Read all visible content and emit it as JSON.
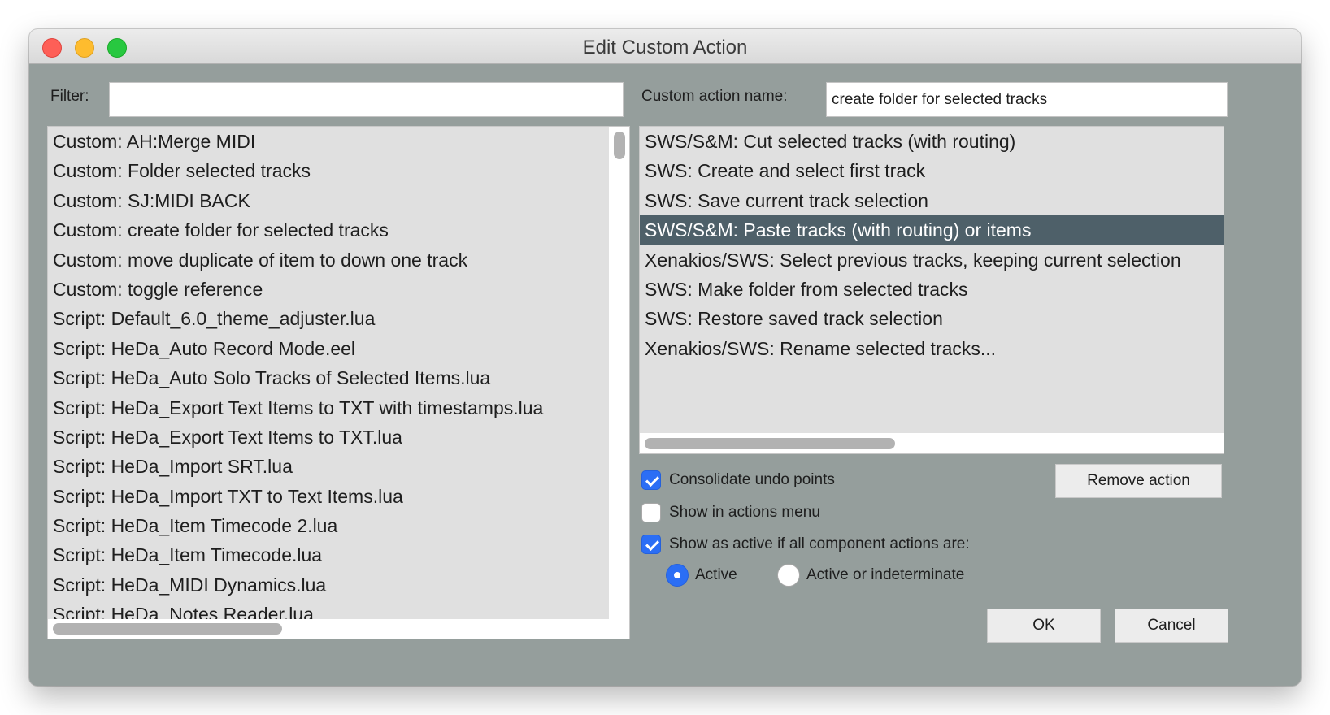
{
  "window": {
    "title": "Edit Custom Action"
  },
  "filter": {
    "label": "Filter:",
    "value": ""
  },
  "name_field": {
    "label": "Custom action name:",
    "value": "create folder for selected tracks"
  },
  "left_list": {
    "items": [
      "Custom: AH:Merge MIDI",
      "Custom: Folder selected tracks",
      "Custom: SJ:MIDI BACK",
      "Custom: create folder for selected tracks",
      "Custom: move duplicate of item to down one track",
      "Custom: toggle reference",
      "Script: Default_6.0_theme_adjuster.lua",
      "Script: HeDa_Auto Record Mode.eel",
      "Script: HeDa_Auto Solo Tracks of Selected Items.lua",
      "Script: HeDa_Export Text Items to TXT with timestamps.lua",
      "Script: HeDa_Export Text Items to TXT.lua",
      "Script: HeDa_Import SRT.lua",
      "Script: HeDa_Import TXT to Text Items.lua",
      "Script: HeDa_Item Timecode 2.lua",
      "Script: HeDa_Item Timecode.lua",
      "Script: HeDa_MIDI Dynamics.lua",
      "Script: HeDa_Notes Reader.lua"
    ]
  },
  "right_list": {
    "selected_index": 3,
    "items": [
      "SWS/S&M: Cut selected tracks (with routing)",
      "SWS: Create and select first track",
      "SWS: Save current track selection",
      "SWS/S&M: Paste tracks (with routing) or items",
      "Xenakios/SWS: Select previous tracks, keeping current selection",
      "SWS: Make folder from selected tracks",
      "SWS: Restore saved track selection",
      "Xenakios/SWS: Rename selected tracks..."
    ]
  },
  "options": {
    "consolidate": {
      "label": "Consolidate undo points",
      "checked": true
    },
    "show_in_menu": {
      "label": "Show in actions menu",
      "checked": false
    },
    "show_active": {
      "label": "Show as active if all component actions are:",
      "checked": true
    },
    "radio_active": {
      "label": "Active",
      "selected": true
    },
    "radio_indeterminate": {
      "label": "Active or indeterminate",
      "selected": false
    }
  },
  "buttons": {
    "remove": "Remove action",
    "ok": "OK",
    "cancel": "Cancel"
  },
  "colors": {
    "window_bg": "#959e9c",
    "list_bg": "#e0e0e0",
    "selection": "#4e6069",
    "accent": "#2b6ef5"
  }
}
